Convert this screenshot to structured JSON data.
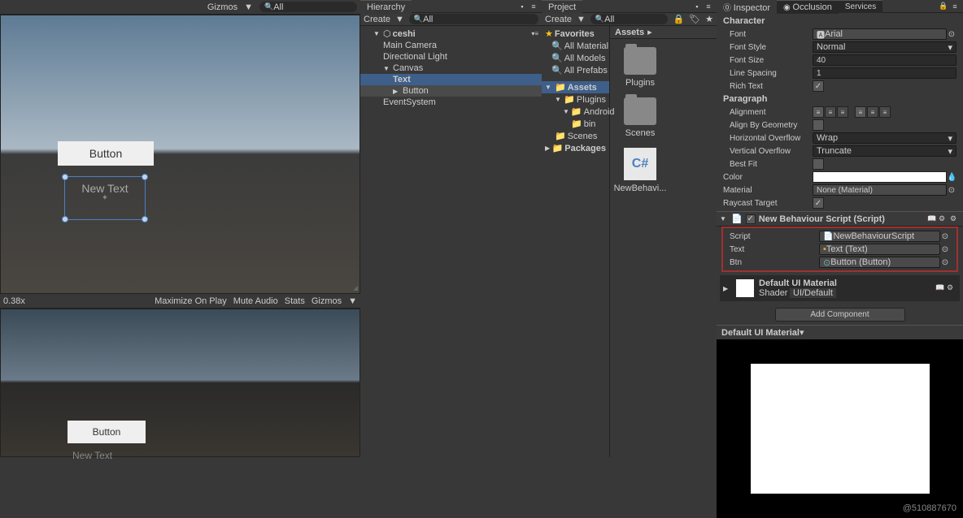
{
  "hierarchy": {
    "tab": "Hierarchy",
    "create": "Create",
    "search_ph": "All",
    "scene": "ceshi",
    "items": [
      "Main Camera",
      "Directional Light",
      "Canvas",
      "Text",
      "Button",
      "EventSystem"
    ]
  },
  "project": {
    "tab": "Project",
    "create": "Create",
    "search_ph": "All",
    "favorites": "Favorites",
    "fav_items": [
      "All Material",
      "All Models",
      "All Prefabs"
    ],
    "assets": "Assets",
    "tree": [
      "Plugins",
      "Android",
      "bin",
      "Scenes"
    ],
    "packages": "Packages",
    "breadcrumb": "Assets",
    "grid": [
      "Plugins",
      "Scenes",
      "NewBehavi..."
    ],
    "script_label": "C#"
  },
  "scene": {
    "gizmos": "Gizmos",
    "search_ph": "All",
    "button_text": "Button",
    "new_text": "New Text"
  },
  "game": {
    "zoom": "0.38x",
    "maximize": "Maximize On Play",
    "mute": "Mute Audio",
    "stats": "Stats",
    "gizmos": "Gizmos",
    "button_text": "Button",
    "new_text": "New Text"
  },
  "inspector": {
    "tab": "Inspector",
    "occlusion": "Occlusion",
    "services": "Services",
    "character": "Character",
    "font_lbl": "Font",
    "font_val": "Arial",
    "font_style_lbl": "Font Style",
    "font_style_val": "Normal",
    "font_size_lbl": "Font Size",
    "font_size_val": "40",
    "line_spacing_lbl": "Line Spacing",
    "line_spacing_val": "1",
    "rich_text_lbl": "Rich Text",
    "paragraph": "Paragraph",
    "alignment_lbl": "Alignment",
    "align_geom_lbl": "Align By Geometry",
    "h_overflow_lbl": "Horizontal Overflow",
    "h_overflow_val": "Wrap",
    "v_overflow_lbl": "Vertical Overflow",
    "v_overflow_val": "Truncate",
    "best_fit_lbl": "Best Fit",
    "color_lbl": "Color",
    "material_lbl": "Material",
    "material_val": "None (Material)",
    "raycast_lbl": "Raycast Target",
    "script_comp": "New Behaviour Script (Script)",
    "script_lbl": "Script",
    "script_val": "NewBehaviourScript",
    "text_lbl": "Text",
    "text_val": "Text (Text)",
    "btn_lbl": "Btn",
    "btn_val": "Button (Button)",
    "mat_name": "Default UI Material",
    "shader_lbl": "Shader",
    "shader_val": "UI/Default",
    "add_comp": "Add Component",
    "preview_title": "Default UI Material"
  },
  "watermark": "@510887670"
}
